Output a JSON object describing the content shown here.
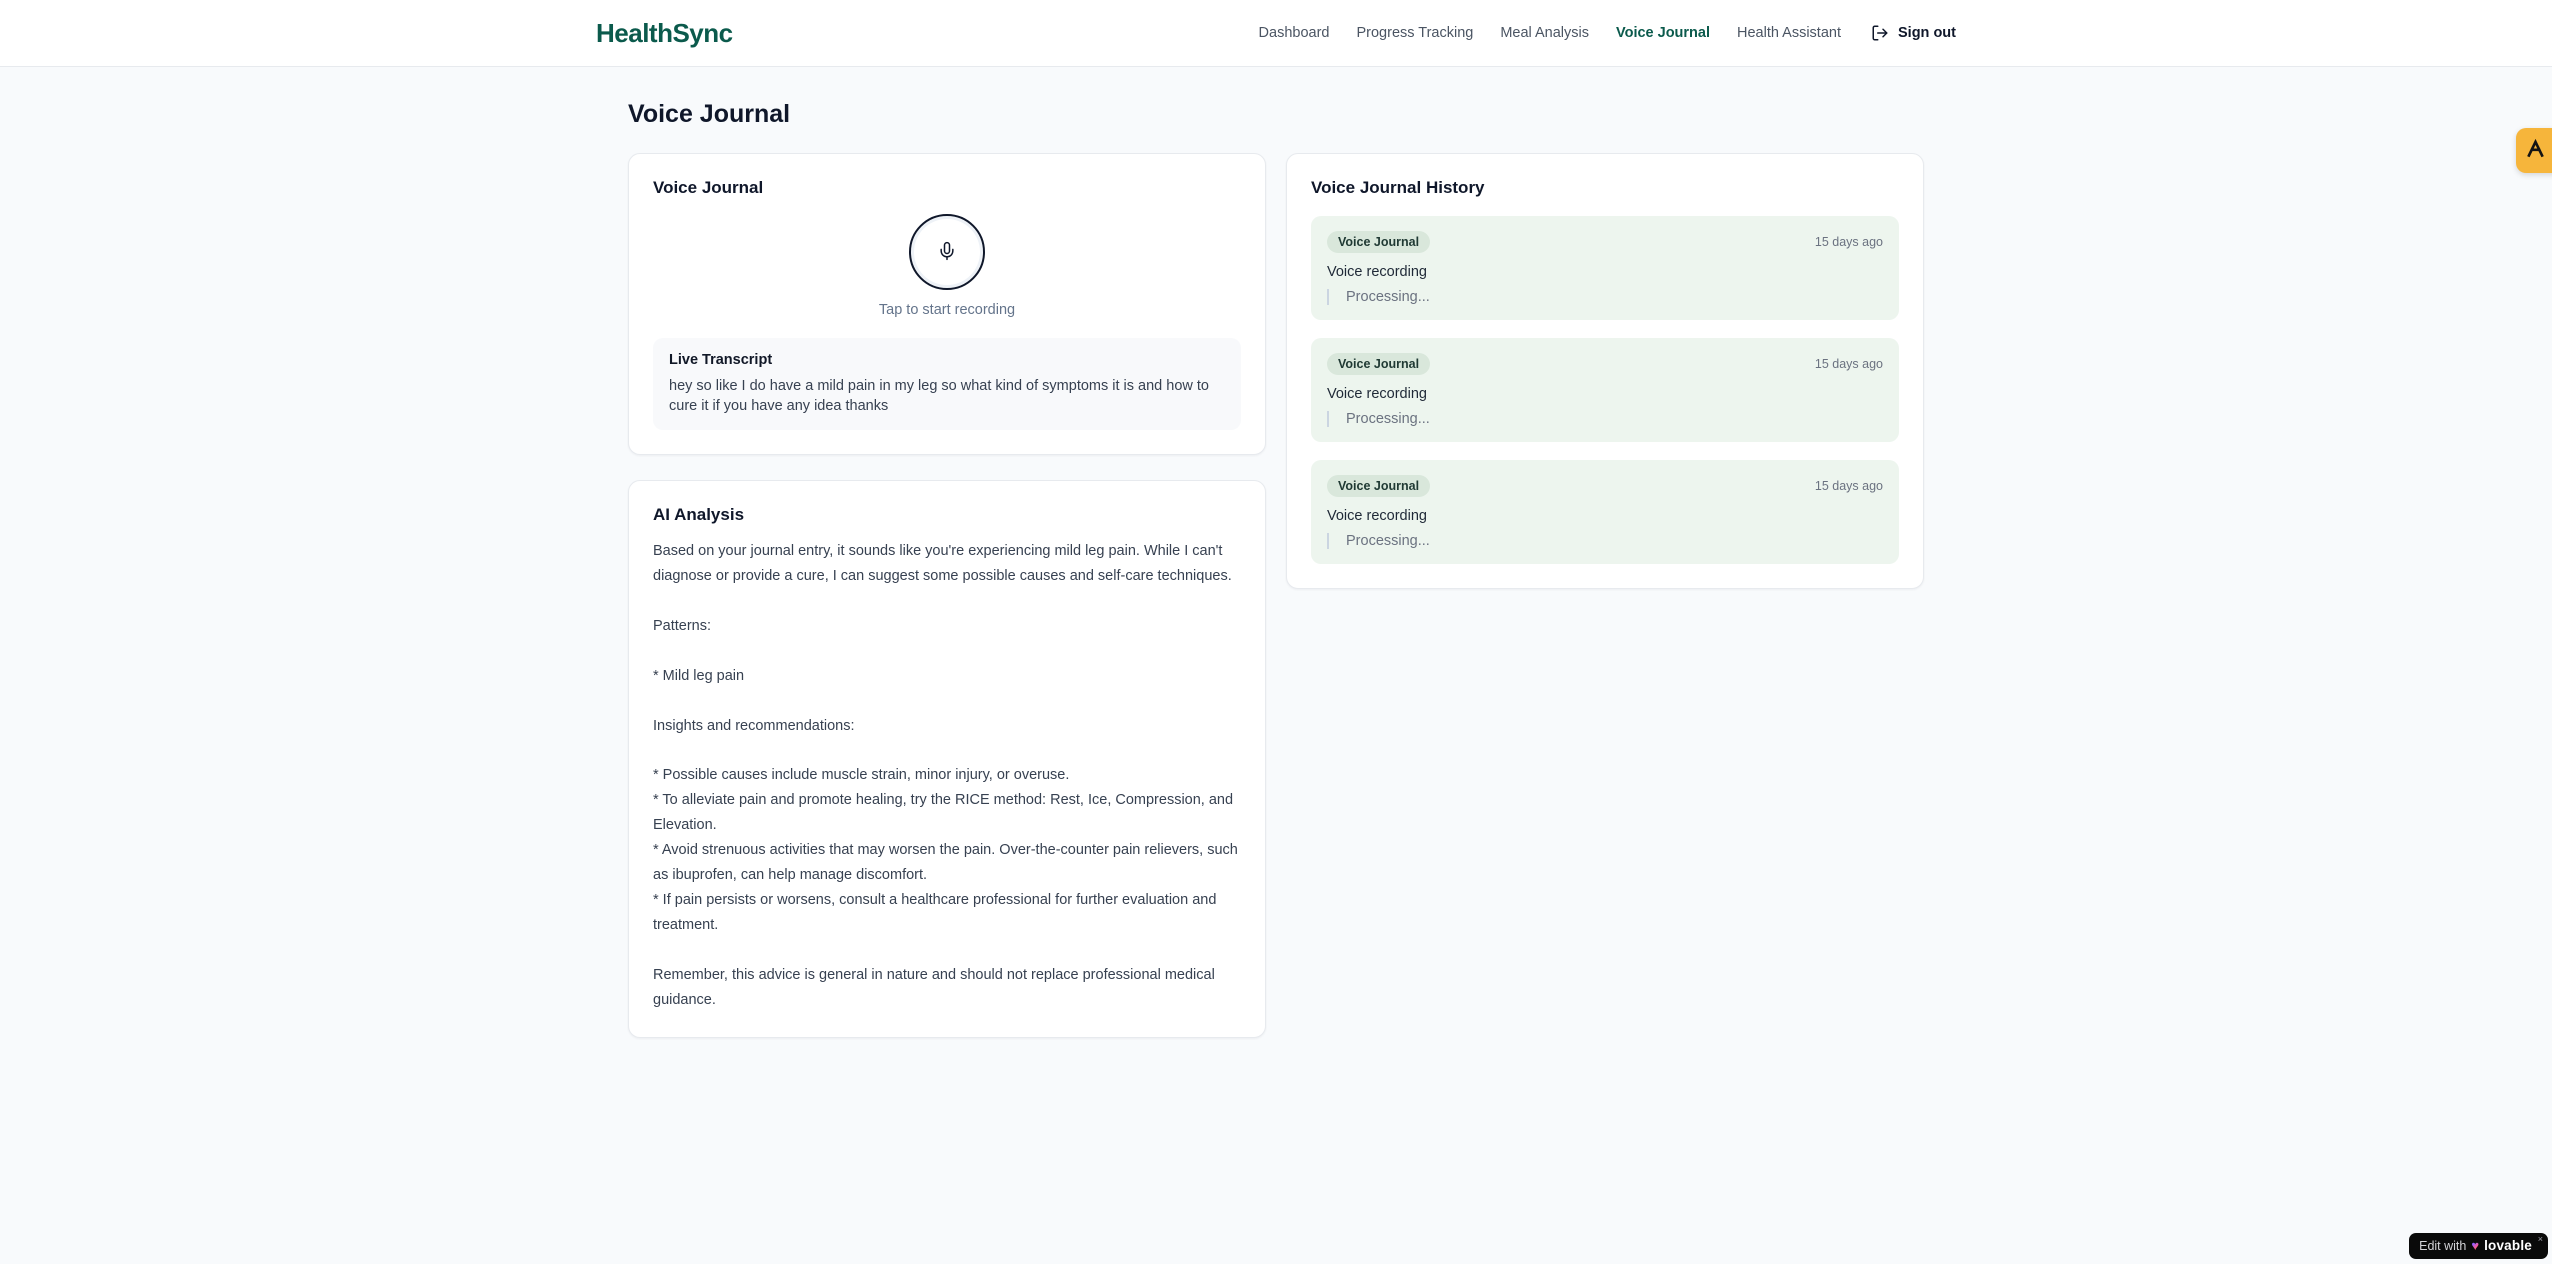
{
  "app": {
    "name": "HealthSync"
  },
  "header": {
    "nav": [
      {
        "label": "Dashboard",
        "active": false
      },
      {
        "label": "Progress Tracking",
        "active": false
      },
      {
        "label": "Meal Analysis",
        "active": false
      },
      {
        "label": "Voice Journal",
        "active": true
      },
      {
        "label": "Health Assistant",
        "active": false
      }
    ],
    "sign_out_label": "Sign out",
    "sign_out_icon": "log-out-icon"
  },
  "page": {
    "title": "Voice Journal"
  },
  "recorder_card": {
    "title": "Voice Journal",
    "mic_icon": "microphone-icon",
    "tap_hint": "Tap to start recording",
    "live_transcript": {
      "title": "Live Transcript",
      "text": "hey so like I do have a mild pain in my leg so what kind of symptoms it is and how to cure it if you have any idea thanks"
    }
  },
  "analysis_card": {
    "title": "AI Analysis",
    "body": "Based on your journal entry, it sounds like you're experiencing mild leg pain. While I can't diagnose or provide a cure, I can suggest some possible causes and self-care techniques.\n\nPatterns:\n\n* Mild leg pain\n\nInsights and recommendations:\n\n* Possible causes include muscle strain, minor injury, or overuse.\n* To alleviate pain and promote healing, try the RICE method: Rest, Ice, Compression, and Elevation.\n* Avoid strenuous activities that may worsen the pain. Over-the-counter pain relievers, such as ibuprofen, can help manage discomfort.\n* If pain persists or worsens, consult a healthcare professional for further evaluation and treatment.\n\nRemember, this advice is general in nature and should not replace professional medical guidance."
  },
  "history_card": {
    "title": "Voice Journal History",
    "items": [
      {
        "badge": "Voice Journal",
        "time": "15 days ago",
        "title": "Voice recording",
        "status": "Processing..."
      },
      {
        "badge": "Voice Journal",
        "time": "15 days ago",
        "title": "Voice recording",
        "status": "Processing..."
      },
      {
        "badge": "Voice Journal",
        "time": "15 days ago",
        "title": "Voice recording",
        "status": "Processing..."
      }
    ]
  },
  "floating": {
    "side_badge_icon": "a-logo-icon",
    "lovable": {
      "prefix": "Edit with",
      "heart_icon": "heart-icon",
      "brand": "lovable",
      "close": "×"
    }
  },
  "colors": {
    "brand_green": "#0b5a4c",
    "page_bg": "#f8fafc",
    "history_item_bg": "#edf5ee",
    "history_badge_bg": "#d9e7db",
    "side_badge_amber": "#f6b53b",
    "lovable_badge_bg": "#0a0a0a",
    "muted_text": "#6b7280",
    "body_text": "#374151"
  }
}
